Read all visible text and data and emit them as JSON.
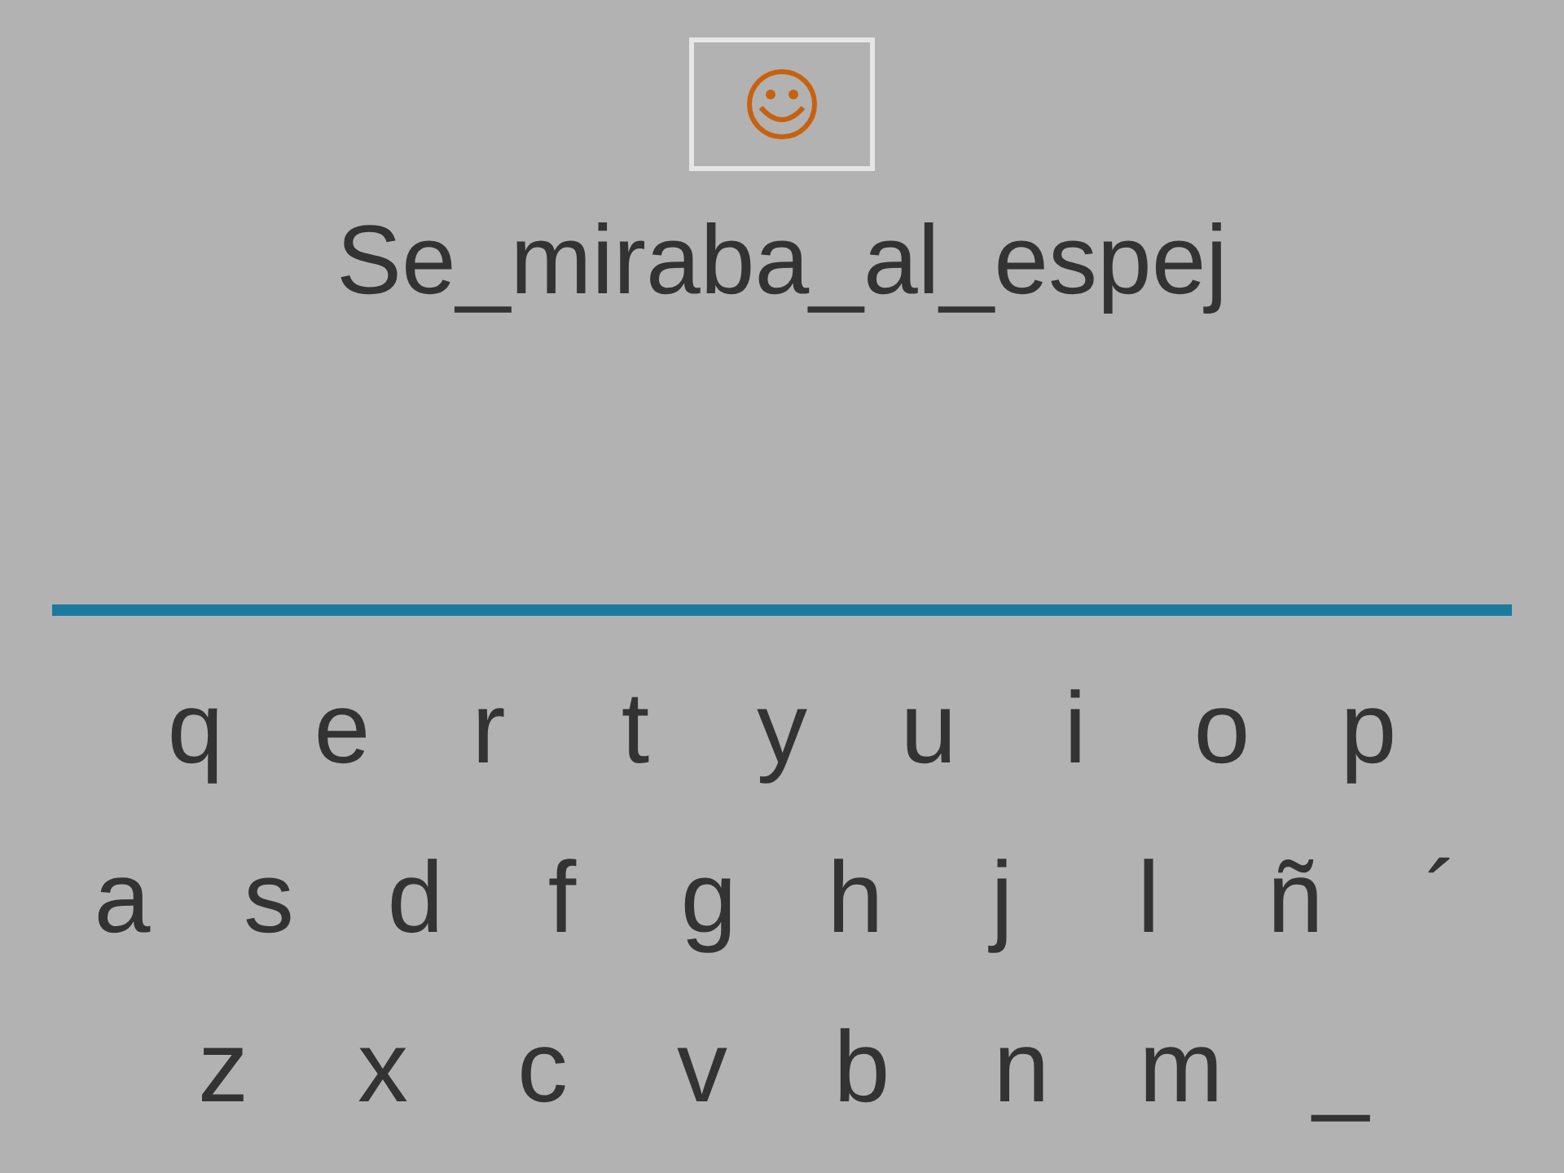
{
  "word": "Se_miraba_al_espej",
  "keyboard": [
    [
      "q",
      "e",
      "r",
      "t",
      "y",
      "u",
      "i",
      "o",
      "p"
    ],
    [
      "a",
      "s",
      "d",
      "f",
      "g",
      "h",
      "j",
      "l",
      "ñ",
      "´"
    ],
    [
      "z",
      "x",
      "c",
      "v",
      "b",
      "n",
      "m",
      "_"
    ]
  ]
}
